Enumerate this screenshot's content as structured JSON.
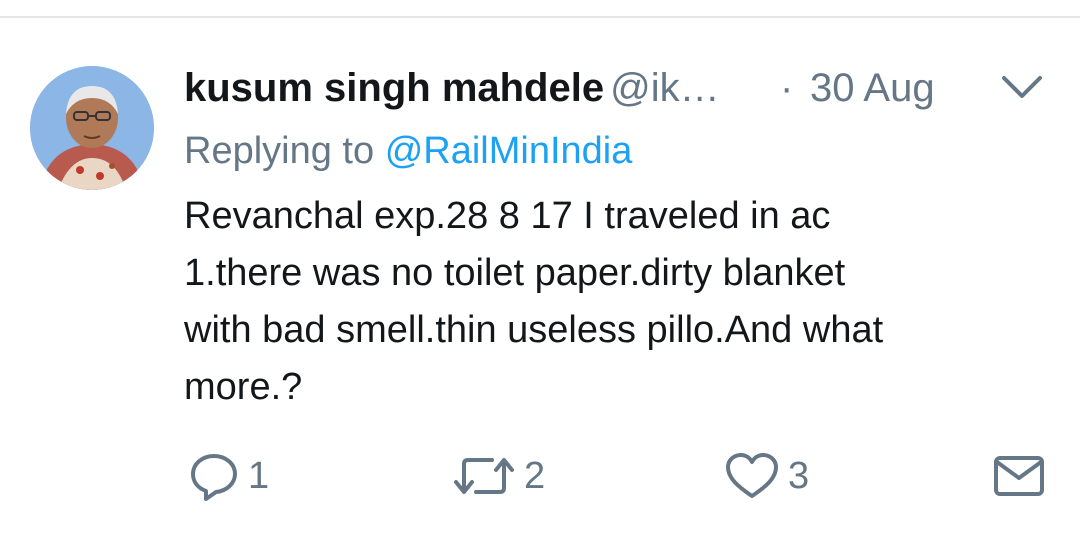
{
  "tweet": {
    "display_name": "kusum singh mahdele",
    "handle": "@ik…",
    "separator": "·",
    "date": "30 Aug",
    "reply_prefix": "Replying to",
    "reply_handle": "@RailMinIndia",
    "text_lines": [
      "Revanchal exp.28 8 17 I traveled in ac",
      "1.there was no toilet paper.dirty blanket",
      "with bad smell.thin useless pillo.And what",
      "more.?"
    ]
  },
  "actions": {
    "reply_count": "1",
    "retweet_count": "2",
    "like_count": "3"
  },
  "colors": {
    "primary_text": "#14171a",
    "secondary_text": "#657786",
    "link": "#1da1f2",
    "icon": "#657786",
    "divider": "#e1e8ed"
  },
  "icons": [
    "avatar",
    "chevron-down-icon",
    "reply-icon",
    "retweet-icon",
    "like-icon",
    "message-icon"
  ]
}
